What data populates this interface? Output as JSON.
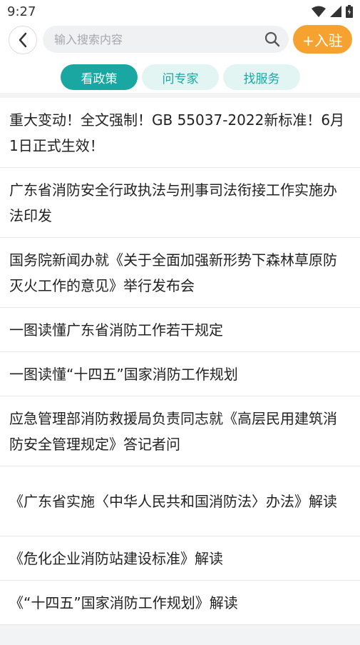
{
  "status": {
    "time": "9:27"
  },
  "header": {
    "search_placeholder": "输入搜索内容",
    "join_label": "+入驻"
  },
  "tabs": [
    {
      "label": "看政策",
      "active": true
    },
    {
      "label": "问专家",
      "active": false
    },
    {
      "label": "找服务",
      "active": false
    }
  ],
  "articles": [
    {
      "title": "重大变动！全文强制！GB 55037-2022新标准！6月1日正式生效！"
    },
    {
      "title": "广东省消防安全行政执法与刑事司法衔接工作实施办法印发"
    },
    {
      "title": "国务院新闻办就《关于全面加强新形势下森林草原防灭火工作的意见》举行发布会"
    },
    {
      "title": "一图读懂广东省消防工作若干规定"
    },
    {
      "title": "一图读懂“十四五”国家消防工作规划"
    },
    {
      "title": "应急管理部消防救援局负责同志就《高层民用建筑消防安全管理规定》答记者问"
    },
    {
      "title": "《广东省实施〈中华人民共和国消防法〉办法》解读"
    },
    {
      "title": "《危化企业消防站建设标准》解读"
    },
    {
      "title": "《“十四五”国家消防工作规划》解读"
    }
  ],
  "colors": {
    "accent": "#1aa7a2",
    "brand_orange": "#f5a231"
  },
  "icons": [
    "wifi-icon",
    "signal-icon",
    "battery-icon",
    "chevron-left-icon",
    "search-icon"
  ]
}
